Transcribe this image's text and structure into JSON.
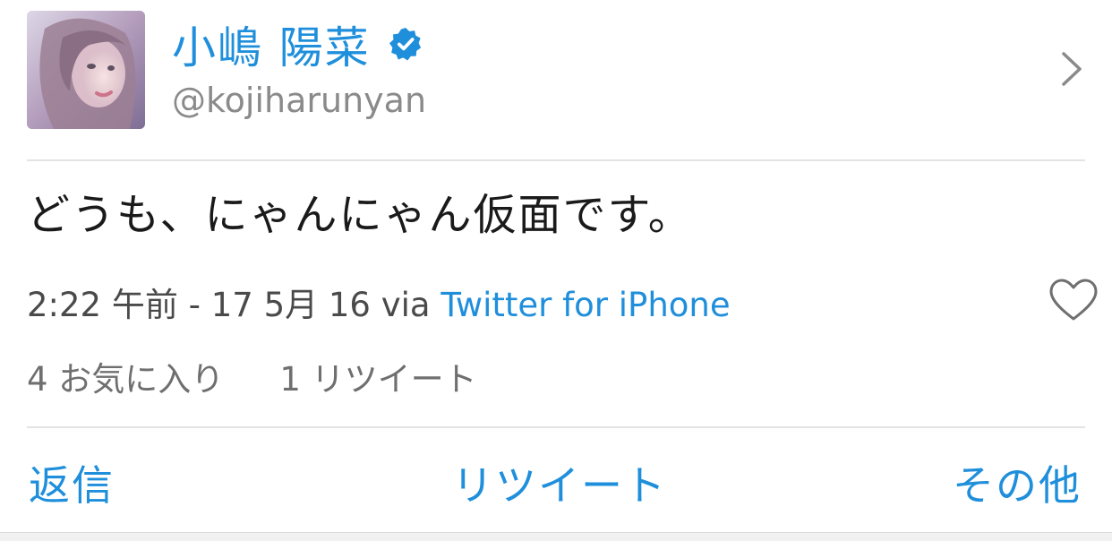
{
  "user": {
    "display_name": "小嶋 陽菜",
    "handle": "@kojiharunyan",
    "verified_icon": "verified-badge-icon",
    "avatar_icon": "profile-photo"
  },
  "tweet": {
    "text": "どうも、にゃんにゃん仮面です。",
    "timestamp": "2:22 午前 - 17 5月 16",
    "via_label": "via",
    "via_app": "Twitter for iPhone"
  },
  "stats": {
    "favorites": "4 お気に入り",
    "retweets": "1 リツイート"
  },
  "actions": {
    "reply": "返信",
    "retweet": "リツイート",
    "more": "その他"
  },
  "colors": {
    "accent": "#1f8fdc",
    "text": "#1a1a1a",
    "muted": "#8a8a8a",
    "divider": "#e3e3e3"
  }
}
